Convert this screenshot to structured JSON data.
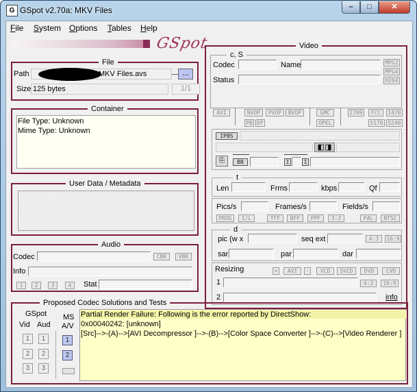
{
  "window": {
    "title": "GSpot v2.70a: MKV Files",
    "app_icon": "gspot-app-icon",
    "min": "–",
    "max": "□",
    "close": "✕"
  },
  "menu": [
    {
      "accel": "F",
      "rest": "ile"
    },
    {
      "accel": "S",
      "rest": "ystem"
    },
    {
      "accel": "O",
      "rest": "ptions"
    },
    {
      "accel": "T",
      "rest": "ables"
    },
    {
      "accel": "H",
      "rest": "elp"
    }
  ],
  "logo": "GSpot",
  "file": {
    "title": "File",
    "path_label": "Path",
    "path_value": "MKV Files.avs",
    "browse": "...",
    "size_label": "Size",
    "size_value": "125 bytes",
    "page": "1/1"
  },
  "container": {
    "title": "Container",
    "line1": "File Type: Unknown",
    "line2": "Mime Type: Unknown"
  },
  "userdata": {
    "title": "User Data / Metadata"
  },
  "audio": {
    "title": "Audio",
    "codec_label": "Codec",
    "cbr": "CBR",
    "vbr": "VBR",
    "info_label": "Info",
    "nums": [
      "1",
      "2",
      "3",
      "4"
    ],
    "stat_label": "Stat"
  },
  "video": {
    "title": "Video",
    "cs_title": "c, S",
    "codec_label": "Codec",
    "name_label": "Name",
    "status_label": "Status",
    "mpg_tags": [
      "MPG2",
      "MPG4",
      "H264"
    ],
    "avi": "AVI",
    "row1_tags": [
      "NVOP",
      "PVOP",
      "BVOP"
    ],
    "row2_tags": [
      "PB",
      "DF"
    ],
    "gmc": "GMC",
    "opel": "OPEL",
    "itags1": [
      "I709",
      "FCC",
      "I470"
    ],
    "itags2": [
      "S170",
      "S240"
    ],
    "ipbs": "IPBS",
    "bb": "BB",
    "i1": "I",
    "i2": "I",
    "t_title": "t",
    "len_label": "Len",
    "frms_label": "Frms",
    "kbps_label": "kbps",
    "qf_label": "Qf",
    "pics_label": "Pics/s",
    "frames_label": "Frames/s",
    "fields_label": "Fields/s",
    "rate_tags": [
      "PROG",
      "I/L",
      "TFF",
      "BFF",
      "PPF",
      "3:2",
      "PAL",
      "NTSC"
    ],
    "d_title": "d",
    "pic_label": "pic (w x",
    "seq_label": "seq ext",
    "ar_tags": [
      "4:3",
      "16:9"
    ],
    "sar_label": "sar",
    "par_label": "par",
    "dar_label": "dar",
    "resizing_label": "Resizing",
    "plus": "+",
    "avi_btn": "AVI",
    "minus": "-",
    "vcd": "VCD",
    "svcd": "SVCD",
    "dvd": "DVD",
    "cvd": "CVD",
    "row1": "1",
    "row2": "2",
    "ar2_tags": [
      "4:3",
      "16:9"
    ],
    "info": "info"
  },
  "codec_solutions": {
    "title": "Proposed Codec Solutions and Tests",
    "gspot_label": "GSpot",
    "vid_label": "Vid",
    "aud_label": "Aud",
    "ms_label": "MS",
    "av_label": "A/V",
    "nums": [
      "1",
      "2",
      "3"
    ],
    "msg1": "Partial Render Failure: Following is the error reported by DirectShow:",
    "msg2": "0x00040242: [unknown]",
    "msg3": "[Src]-->-(A)-->[AVI Decompressor ]-->-(B)-->[Color Space Converter ]-->-(C)-->[Video Renderer ]"
  },
  "colors": {
    "panel_border": "#7a1d3c",
    "highlight": "#ffffc8",
    "title_bg": "#b8d4ea"
  }
}
